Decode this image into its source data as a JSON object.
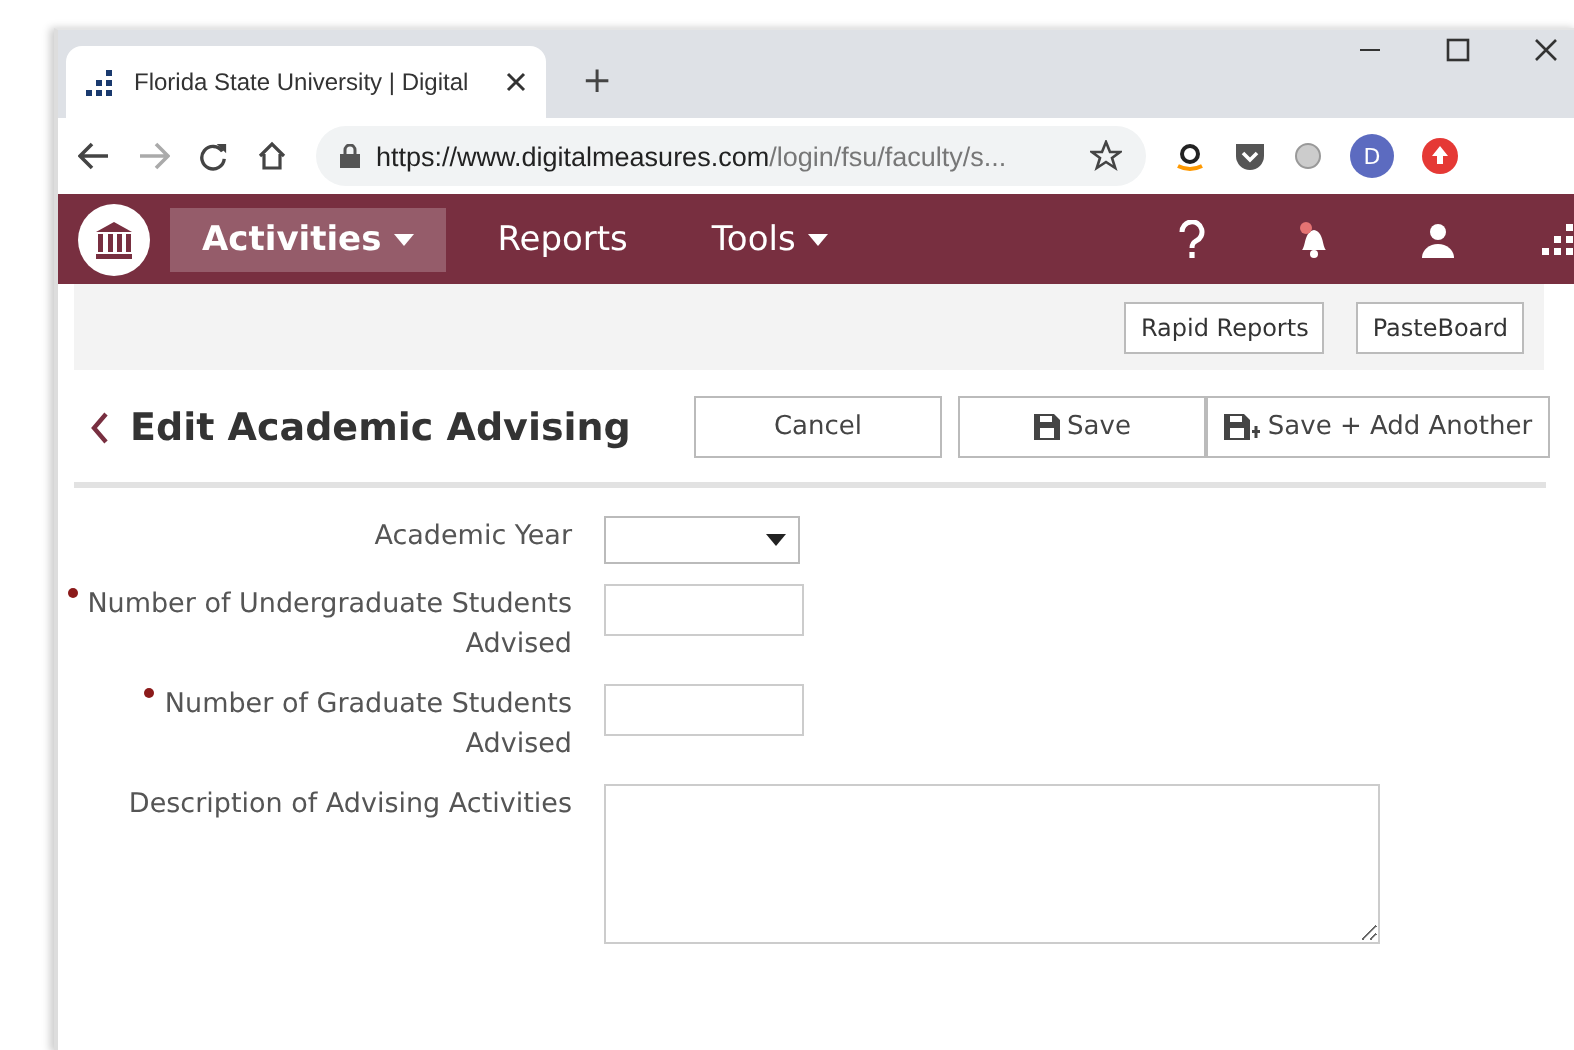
{
  "browser": {
    "tab_title": "Florida State University | Digital",
    "new_tab": "+",
    "url_host": "https://www.digitalmeasures.com",
    "url_path": "/login/fsu/faculty/s...",
    "profile_initial": "D"
  },
  "nav": {
    "items": [
      {
        "label": "Activities",
        "selected": true,
        "dropdown": true
      },
      {
        "label": "Reports",
        "selected": false,
        "dropdown": false
      },
      {
        "label": "Tools",
        "selected": false,
        "dropdown": true
      }
    ]
  },
  "toolbar_buttons": [
    "Rapid Reports",
    "PasteBoard"
  ],
  "page_title": "Edit Academic Advising",
  "actions": [
    {
      "label": "Cancel",
      "kind": "plain"
    },
    {
      "label": "Save",
      "kind": "save"
    },
    {
      "label": "Save + Add Another",
      "kind": "save-add"
    }
  ],
  "fields": [
    {
      "label": "Academic Year",
      "kind": "select",
      "required": false
    },
    {
      "label": "Number of Undergraduate Students Advised",
      "kind": "text",
      "required": true
    },
    {
      "label": "Number of Graduate Students Advised",
      "kind": "text",
      "required": true
    },
    {
      "label": "Description of Advising Activities",
      "kind": "textarea",
      "required": false
    }
  ]
}
